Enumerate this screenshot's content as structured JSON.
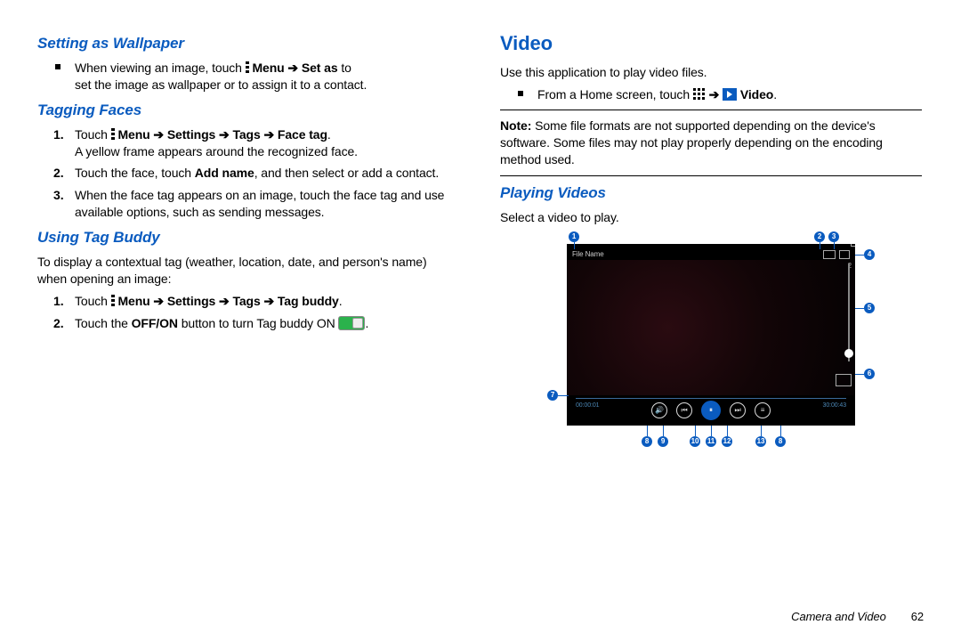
{
  "left": {
    "wallpaper": {
      "heading": "Setting as Wallpaper",
      "bullet_before": "When viewing an image, touch",
      "menu": "Menu",
      "arrow": "➔",
      "setas": "Set as",
      "bullet_after_1": "to",
      "bullet_line2": "set the image as wallpaper or to assign it to a contact."
    },
    "tagging": {
      "heading": "Tagging Faces",
      "s1_a": "Touch",
      "s1_menu": "Menu ➔ Settings ➔ Tags ➔ Face tag",
      "s1_b": "A yellow frame appears around the recognized face.",
      "s2": "Touch the face, touch Add name, and then select or add a contact.",
      "s2_bold": "Add name",
      "s2_before": "Touch the face, touch",
      "s2_after": ", and then select or add a contact.",
      "s3": "When the face tag appears on an image, touch the face tag and use available options, such as sending messages."
    },
    "tagbuddy": {
      "heading": "Using Tag Buddy",
      "intro": "To display a contextual tag (weather, location, date, and person's name) when opening an image:",
      "s1_a": "Touch",
      "s1_menu": "Menu ➔ Settings ➔ Tags ➔ Tag buddy",
      "s2_before": "Touch the",
      "s2_bold": "OFF/ON",
      "s2_after": "button to turn Tag buddy ON"
    }
  },
  "right": {
    "video": {
      "heading": "Video",
      "intro": "Use this application to play video files.",
      "bullet_a": "From a Home screen, touch",
      "arrow": "➔",
      "video_label": "Video",
      "note_label": "Note:",
      "note_text": "Some file formats are not supported depending on the device's software. Some files may not play properly depending on the encoding method used."
    },
    "playing": {
      "heading": "Playing Videos",
      "intro": "Select a video to play.",
      "file_name": "File Name",
      "vol": "2",
      "t_cur": "00:00:01",
      "t_tot": "30:00:43",
      "callouts": [
        "1",
        "2",
        "3",
        "4",
        "5",
        "6",
        "7",
        "8",
        "9",
        "10",
        "11",
        "12",
        "13",
        "8"
      ]
    }
  },
  "footer": {
    "chapter": "Camera and Video",
    "page": "62"
  },
  "period": "."
}
